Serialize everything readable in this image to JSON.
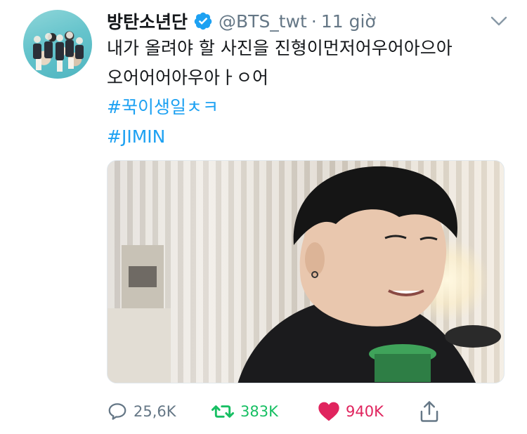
{
  "tweet": {
    "author_name": "방탄소년단",
    "handle": "@BTS_twt",
    "time_sep": "·",
    "time": "11 giờ",
    "text_line1": "내가 올려야 할 사진을 진형이먼저어우어아으아",
    "text_line2": "오어어어아우아ㅏㅇ어",
    "hashtag1": "#꾹이생일ㅊㅋ",
    "hashtag2": "#JIMIN"
  },
  "actions": {
    "replies": "25,6K",
    "retweets": "383K",
    "likes": "940K"
  },
  "colors": {
    "link": "#1da1f2",
    "secondary": "#657786",
    "retweet": "#17bf63",
    "like": "#e0245e"
  },
  "icons": [
    "verified-badge-icon",
    "chevron-down-icon",
    "reply-icon",
    "retweet-icon",
    "heart-icon",
    "share-icon"
  ]
}
